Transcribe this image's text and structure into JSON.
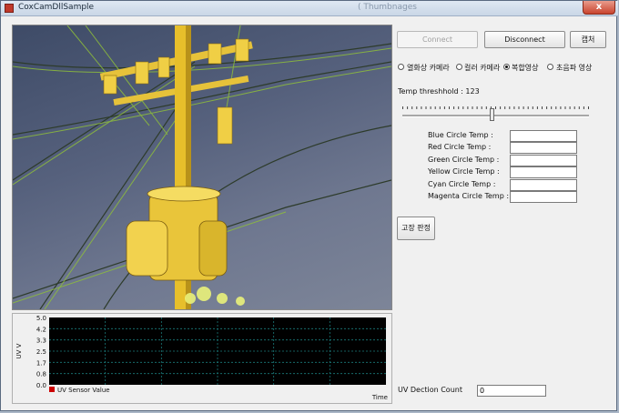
{
  "window": {
    "title": "CoxCamDllSample",
    "ghost_title": "( Thumbnages",
    "close_glyph": "x"
  },
  "toolbar": {
    "connect_label": "Connect",
    "disconnect_label": "Disconnect",
    "capture_label": "캡처"
  },
  "mode": {
    "options": [
      "열화상 카메라",
      "컬러 카메라",
      "복합영상",
      "초음파 영상"
    ],
    "selected": "복합영상"
  },
  "threshold": {
    "label": "Temp  threshhold : 123",
    "value": 123,
    "min": 0,
    "max": 255
  },
  "circle_temps": [
    {
      "label": "Blue Circle Temp    :",
      "value": ""
    },
    {
      "label": "Red Circle Temp      :",
      "value": ""
    },
    {
      "label": "Green Circle Temp :",
      "value": ""
    },
    {
      "label": "Yellow Circle Temp   :",
      "value": ""
    },
    {
      "label": "Cyan Circle Temp     :",
      "value": ""
    },
    {
      "label": "Magenta Circle Temp :",
      "value": ""
    }
  ],
  "diagnose_button": "고장 판정",
  "uv": {
    "count_label": "UV Dection Count",
    "count_value": "0"
  },
  "chart_data": {
    "type": "line",
    "ylabel": "UV V",
    "xlabel": "Time",
    "yticks": [
      "5.0",
      "4.2",
      "3.3",
      "2.5",
      "1.7",
      "0.8",
      "0.0"
    ],
    "ylim": [
      0,
      5
    ],
    "series": [
      {
        "name": "UV Sensor Value",
        "values": []
      }
    ],
    "legend": "bottom-left",
    "grid": true,
    "colors": {
      "background": "#000000",
      "grid": "#1a7a7a",
      "series": "#cc0000"
    }
  }
}
